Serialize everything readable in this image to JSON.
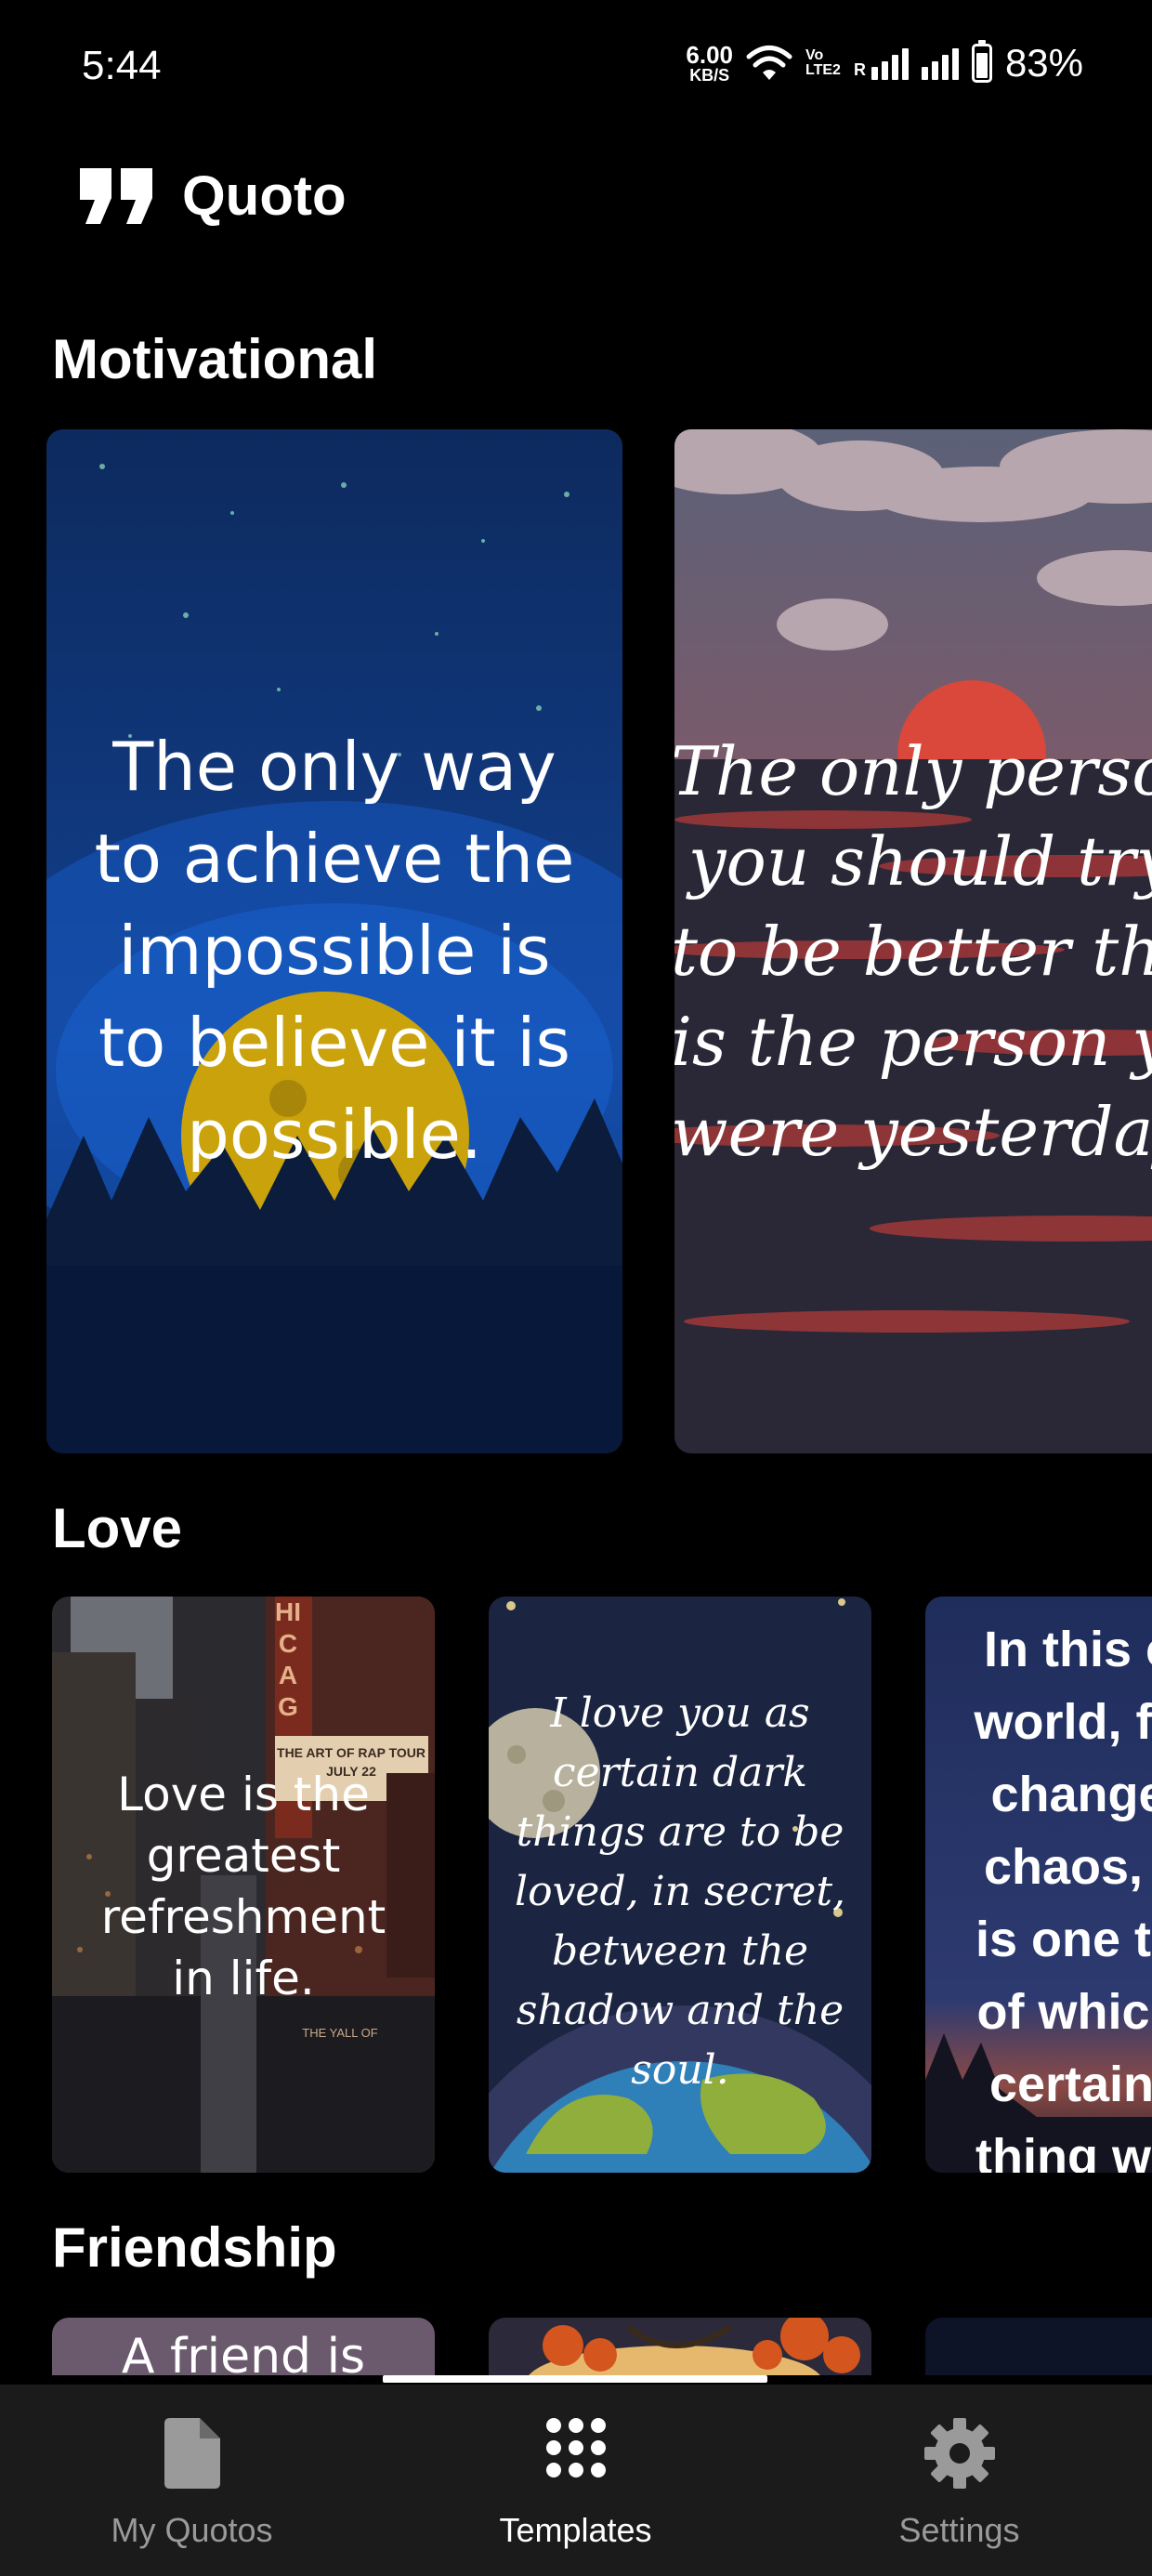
{
  "status_bar": {
    "time": "5:44",
    "net_speed_value": "6.00",
    "net_speed_unit": "KB/S",
    "volte_top": "Vo",
    "volte_bottom": "LTE2",
    "roaming": "R",
    "battery_percent": "83%",
    "battery_level": 0.83
  },
  "app_bar": {
    "title": "Quoto",
    "logo_icon": "quote-mark-icon"
  },
  "sections": [
    {
      "title": "Motivational",
      "cards": [
        {
          "lines": [
            "The only way",
            "to achieve the",
            "impossible is",
            "to believe it is",
            "possible."
          ]
        },
        {
          "lines": [
            "The only person",
            "you should try",
            "to be better than",
            "is the person you",
            "were yesterday."
          ]
        }
      ]
    },
    {
      "title": "Love",
      "cards": [
        {
          "lines": [
            "Love is the",
            "greatest",
            "refreshment",
            "in life."
          ],
          "sign_lines": [
            "THE ART OF RAP TOUR",
            "JULY 22"
          ],
          "marquee_letters": "HICAG",
          "lower_sign": "THE YALL OF"
        },
        {
          "lines": [
            "I love you as",
            "certain dark",
            "things are to be",
            "loved, in secret,",
            "between the",
            "shadow and the",
            "soul."
          ]
        },
        {
          "lines": [
            "In this c",
            "world, fu",
            "change",
            "chaos, t",
            "is one th",
            "of which",
            "certain,",
            "thing wh"
          ]
        }
      ]
    },
    {
      "title": "Friendship",
      "cards": [
        {
          "lines": [
            "A friend is"
          ]
        }
      ]
    }
  ],
  "bottom_nav": {
    "items": [
      {
        "label": "My Quotos",
        "icon": "document-icon",
        "active": false
      },
      {
        "label": "Templates",
        "icon": "grid-dots-icon",
        "active": true
      },
      {
        "label": "Settings",
        "icon": "gear-icon",
        "active": false
      }
    ]
  }
}
